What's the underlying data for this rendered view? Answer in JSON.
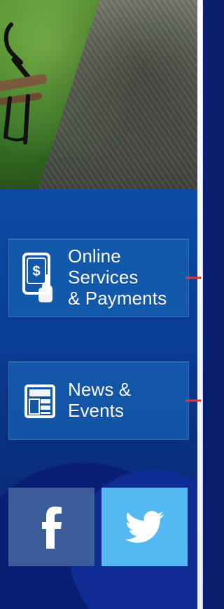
{
  "hero": {
    "icon_names": [
      "park-bench-icon"
    ]
  },
  "cards": [
    {
      "id": "online-services-payments",
      "icon": "online-payment-icon",
      "label_lines": [
        "Online Services",
        "& Payments"
      ]
    },
    {
      "id": "news-events",
      "icon": "newspaper-icon",
      "label_lines": [
        "News & Events"
      ]
    }
  ],
  "social": {
    "facebook": {
      "label": "f",
      "icon": "facebook-icon",
      "color": "#3b5b99"
    },
    "twitter": {
      "label": "",
      "icon": "twitter-icon",
      "color": "#55b9f1"
    }
  },
  "accents": {
    "connector_red": "#e5303a",
    "card_blue": "rgba(20,95,175,0.78)"
  }
}
